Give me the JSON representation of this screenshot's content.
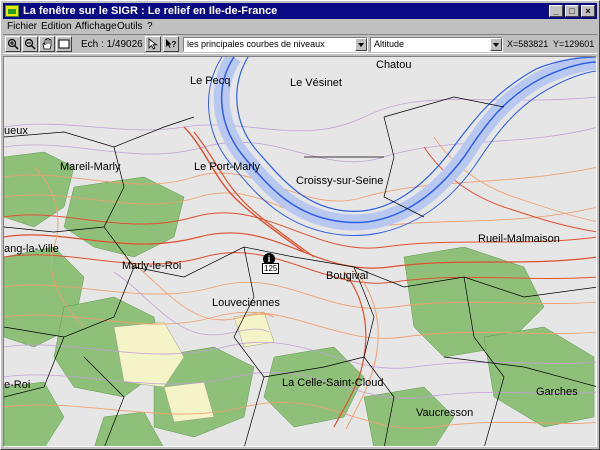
{
  "window": {
    "title": "La fenêtre sur le SIGR :   Le relief en Ile-de-France",
    "app_icon": "sigr-map-icon",
    "controls": {
      "minimize": "_",
      "maximize": "□",
      "close": "×"
    }
  },
  "menu": {
    "items": [
      {
        "label": "Fichier"
      },
      {
        "label": "Edition"
      },
      {
        "label": "Affichage"
      },
      {
        "label": "Outils"
      },
      {
        "label": "?"
      }
    ]
  },
  "toolbar": {
    "scale_label": "Ech : 1/49026",
    "layer_select": "les principales courbes de niveaux",
    "theme_select": "Altitude",
    "coord_x": "X=583821",
    "coord_y": "Y=129601"
  },
  "map": {
    "colors": {
      "background": "#e6e6e6",
      "river": "#2f5fe8",
      "river_fill": "#b8c8f0",
      "forest": "#8fc07a",
      "contour_low": "#c4a0d8",
      "contour_mid": "#f0a070",
      "contour_high": "#e05030",
      "boundary": "#000000"
    },
    "places": [
      {
        "id": "chatou",
        "name": "Chatou"
      },
      {
        "id": "le-pecq",
        "name": "Le Pecq"
      },
      {
        "id": "le-vesinet",
        "name": "Le Vésinet"
      },
      {
        "id": "mareil-marly",
        "name": "Mareil-Marly"
      },
      {
        "id": "le-port-marly",
        "name": "Le Port-Marly"
      },
      {
        "id": "croissy",
        "name": "Croissy-sur-Seine"
      },
      {
        "id": "rueil",
        "name": "Rueil-Malmaison"
      },
      {
        "id": "marly-le-roi",
        "name": "Marly-le-Roi"
      },
      {
        "id": "bougival",
        "name": "Bougival"
      },
      {
        "id": "louveciennes",
        "name": "Louveciennes"
      },
      {
        "id": "etang",
        "name": "ang-la-Ville"
      },
      {
        "id": "la-celle",
        "name": "La Celle-Saint-Cloud"
      },
      {
        "id": "garches",
        "name": "Garches"
      },
      {
        "id": "vaucresson",
        "name": "Vaucresson"
      },
      {
        "id": "le-roi",
        "name": "e-Roi"
      },
      {
        "id": "ueux",
        "name": "ueux"
      }
    ],
    "road_marker": "125",
    "info_icon": "i"
  }
}
